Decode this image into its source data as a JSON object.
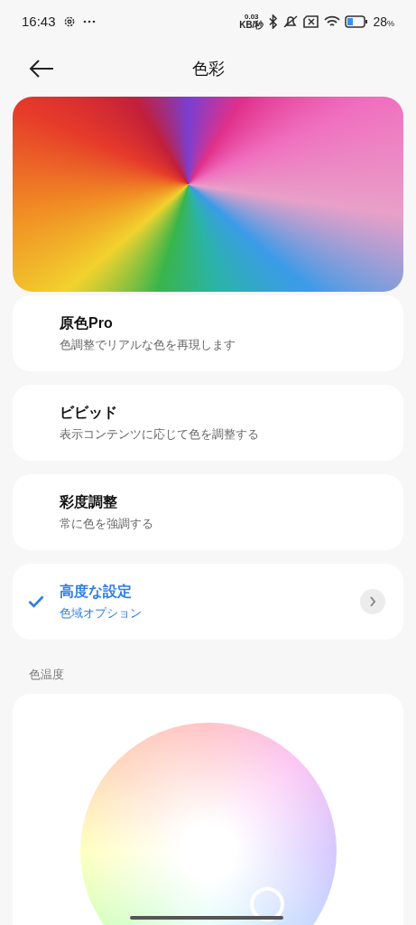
{
  "status_bar": {
    "time": "16:43",
    "net_speed_value": "0.03",
    "net_speed_unit": "KB/秒",
    "battery": "28",
    "battery_unit": "%"
  },
  "header": {
    "title": "色彩"
  },
  "modes": [
    {
      "title": "原色Pro",
      "subtitle": "色調整でリアルな色を再現します",
      "selected": false,
      "has_detail": false
    },
    {
      "title": "ビビッド",
      "subtitle": "表示コンテンツに応じて色を調整する",
      "selected": false,
      "has_detail": false
    },
    {
      "title": "彩度調整",
      "subtitle": "常に色を強調する",
      "selected": false,
      "has_detail": false
    },
    {
      "title": "高度な設定",
      "subtitle": "色域オプション",
      "selected": true,
      "has_detail": true
    }
  ],
  "color_temperature": {
    "label": "色温度"
  }
}
